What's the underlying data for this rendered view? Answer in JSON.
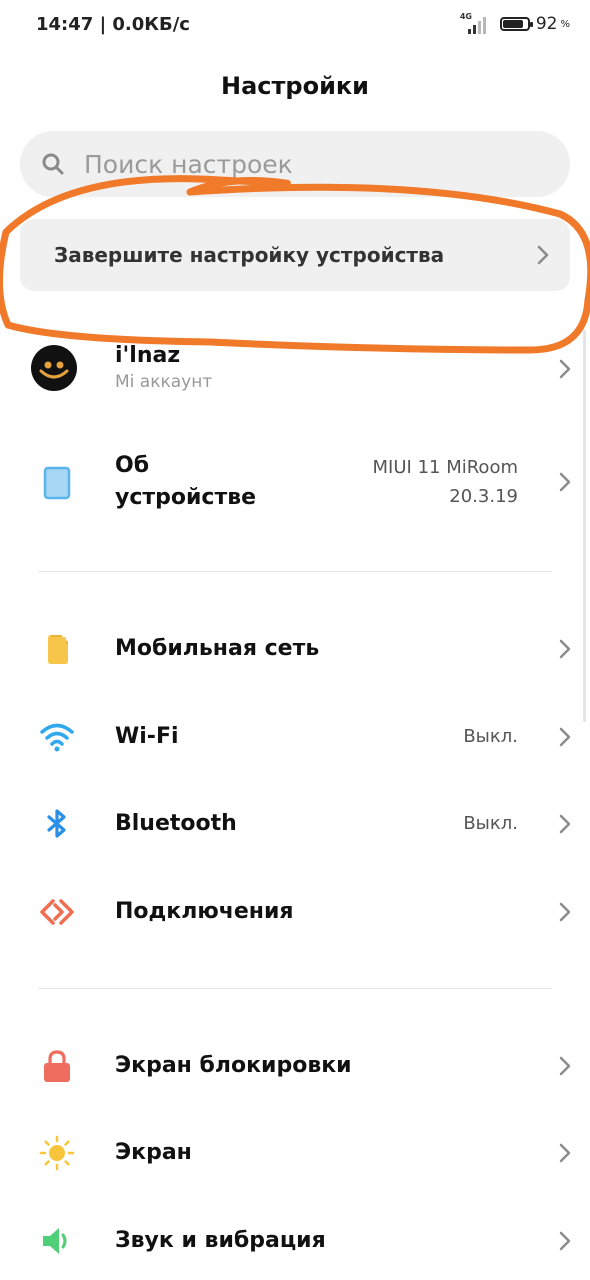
{
  "status_bar": {
    "time_speed": "14:47 | 0.0КБ/с",
    "network": "4G",
    "battery_percent": 92,
    "battery_text": "92",
    "battery_sign": "%"
  },
  "page_title": "Настройки",
  "search": {
    "placeholder": "Поиск настроек"
  },
  "setup_card": {
    "label": "Завершите настройку устройства"
  },
  "account": {
    "name": "i'lnaz",
    "subtitle": "Mi аккаунт"
  },
  "about": {
    "title_line1": "Об",
    "title_line2": "устройстве",
    "version_line1": "MIUI 11 MiRoom",
    "version_line2": "20.3.19"
  },
  "network_items": [
    {
      "label": "Мобильная сеть",
      "value": "",
      "icon": "sim-card-icon"
    },
    {
      "label": "Wi-Fi",
      "value": "Выкл.",
      "icon": "wifi-icon"
    },
    {
      "label": "Bluetooth",
      "value": "Выкл.",
      "icon": "bluetooth-icon"
    },
    {
      "label": "Подключения",
      "value": "",
      "icon": "connection-icon"
    }
  ],
  "system_items": [
    {
      "label": "Экран блокировки",
      "icon": "lock-icon"
    },
    {
      "label": "Экран",
      "icon": "sun-icon"
    },
    {
      "label": "Звук и вибрация",
      "icon": "speaker-icon"
    }
  ],
  "colors": {
    "annotation": "#f07a2a",
    "sim": "#f7c54a",
    "wifi": "#2fa8ee",
    "bluetooth": "#2a8fe6",
    "connection": "#ef6d50",
    "lock": "#ef6d5e",
    "sun": "#f9c53b",
    "speaker": "#4fcf78",
    "device": "#5ab3ea"
  }
}
